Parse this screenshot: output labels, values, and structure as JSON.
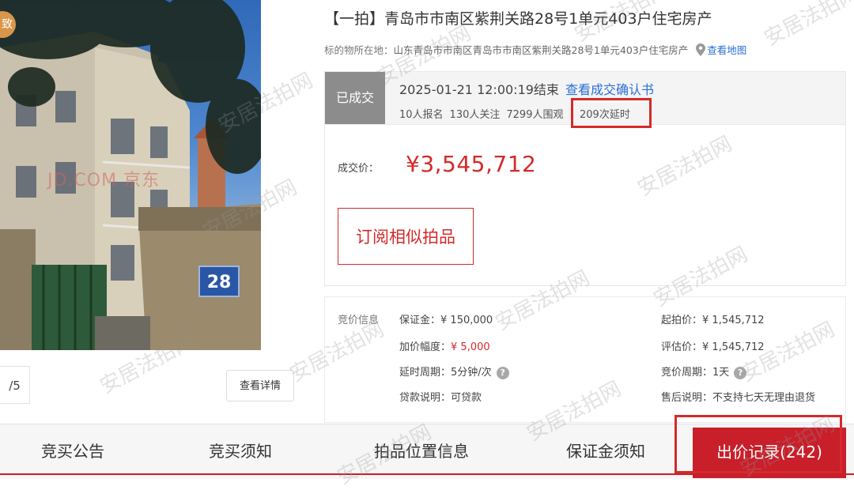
{
  "gallery": {
    "badge": "致",
    "photo_watermark": "JD.COM 京东",
    "house_number": "28",
    "counter": "/5",
    "detail_button": "查看详情"
  },
  "title": "【一拍】青岛市市南区紫荆关路28号1单元403户住宅房产",
  "location": {
    "label": "标的物所在地：",
    "value": "山东青岛市市南区青岛市市南区紫荆关路28号1单元403户住宅房产",
    "map_link": "查看地图"
  },
  "deal": {
    "status": "已成交",
    "end_time": "2025-01-21 12:00:19结束",
    "confirm_link": "查看成交确认书",
    "registrations": "10人报名",
    "followers": "130人关注",
    "onlookers": "7299人围观",
    "delays": "209次延时",
    "price_label": "成交价：",
    "price_value": "¥3,545,712",
    "subscribe_button": "订阅相似拍品"
  },
  "bid_info": {
    "heading": "竞价信息",
    "deposit_label": "保证金：",
    "deposit_value": "¥ 150,000",
    "increment_label": "加价幅度：",
    "increment_value": "¥ 5,000",
    "delay_period_label": "延时周期：",
    "delay_period_value": "5分钟/次",
    "loan_label": "贷款说明：",
    "loan_value": "可贷款",
    "start_price_label": "起拍价：",
    "start_price_value": "¥ 1,545,712",
    "appraisal_label": "评估价：",
    "appraisal_value": "¥ 1,545,712",
    "bid_period_label": "竞价周期：",
    "bid_period_value": "1天",
    "aftersale_label": "售后说明：",
    "aftersale_value": "不支持七天无理由退货"
  },
  "tabs": [
    "竞买公告",
    "竞买须知",
    "拍品位置信息",
    "保证金须知",
    "出价记录(242)"
  ],
  "watermark_text": "安居法拍网",
  "colors": {
    "accent": "#c81f2a",
    "link": "#2a6fd6",
    "status_gray": "#8c8c8c"
  }
}
